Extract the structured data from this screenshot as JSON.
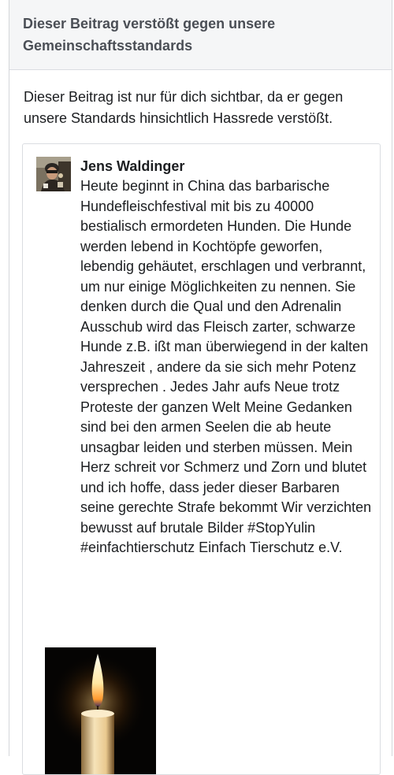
{
  "header": {
    "title": "Dieser Beitrag verstößt gegen unsere Gemeinschaftsstandards"
  },
  "notice": {
    "text": "Dieser Beitrag ist nur für dich sichtbar, da er gegen unsere Standards hinsichtlich Hassrede verstößt."
  },
  "post": {
    "author": "Jens Waldinger",
    "avatar_icon": "profile-photo",
    "body": "Heute beginnt in China das barbarische Hundefleischfestival mit bis zu 40000 bestialisch ermordeten Hunden. Die Hunde werden lebend in Kochtöpfe geworfen, lebendig gehäutet, erschlagen und verbrannt, um nur einige Möglichkeiten zu nennen. Sie denken durch die Qual und den Adrenalin Ausschub wird das Fleisch zarter, schwarze Hunde z.B. ißt man überwiegend in der kalten Jahreszeit , andere da sie sich mehr Potenz versprechen . Jedes Jahr aufs Neue trotz Proteste der ganzen Welt Meine Gedanken sind bei den armen Seelen die ab heute unsagbar leiden und sterben müssen. Mein Herz schreit vor Schmerz und Zorn und blutet und ich hoffe, dass jeder dieser Barbaren seine gerechte Strafe bekommt Wir verzichten bewusst auf brutale Bilder #StopYulin #einfachtierschutz Einfach Tierschutz e.V.",
    "image_icon": "candle-photo"
  },
  "colors": {
    "header_bg": "#f5f6f7",
    "header_text": "#4b4f56",
    "body_text": "#1c1e21",
    "border": "#dadde1"
  }
}
